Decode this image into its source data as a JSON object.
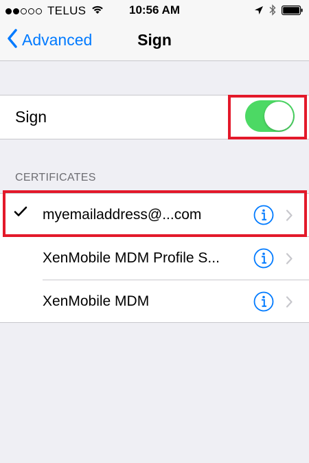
{
  "status_bar": {
    "carrier": "TELUS",
    "time": "10:56 AM",
    "signal_filled": 2,
    "signal_total": 5
  },
  "nav": {
    "back_label": "Advanced",
    "title": "Sign"
  },
  "sign_row": {
    "label": "Sign",
    "toggle_on": true
  },
  "certificates": {
    "header": "CERTIFICATES",
    "items": [
      {
        "label": "myemailaddress@...com",
        "selected": true
      },
      {
        "label": "XenMobile MDM Profile S...",
        "selected": false
      },
      {
        "label": "XenMobile MDM",
        "selected": false
      }
    ]
  },
  "colors": {
    "accent": "#007aff",
    "toggle_on": "#4cd964",
    "highlight": "#e3192a",
    "background": "#efeff4"
  },
  "icons": [
    "location-arrow-icon",
    "bluetooth-icon",
    "battery-icon",
    "wifi-icon",
    "back-chevron-icon",
    "checkmark-icon",
    "info-icon",
    "chevron-right-icon"
  ]
}
